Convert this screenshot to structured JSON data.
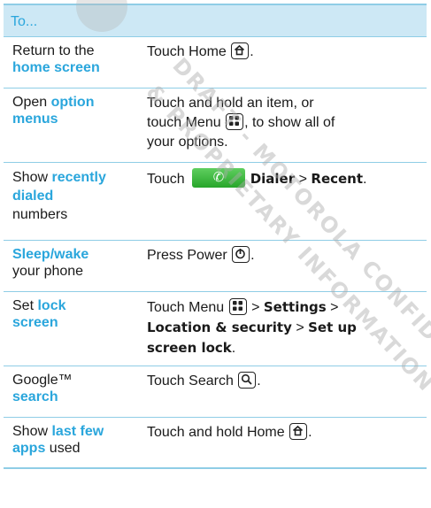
{
  "header": {
    "label": "To..."
  },
  "watermark": {
    "line1": "DRAFT - MOTOROLA CONFIDENTIAL",
    "line2": "& PROPRIETARY INFORMATION"
  },
  "rows": [
    {
      "c1a": "Return to the",
      "c1b": "home screen",
      "t1": "Touch Home",
      "t2": "."
    },
    {
      "c1a": "Open",
      "c1b": "option",
      "c1c": "menus",
      "t1": "Touch and hold an item, or",
      "t2": "touch Menu",
      "t3": ", to show all of",
      "t4": "your options."
    },
    {
      "c1a": "Show",
      "c1b": "recently",
      "c1c": "dialed",
      "c1d": "numbers",
      "t1": "Touch",
      "dialer": "Dialer",
      "sep": ">",
      "recent": "Recent",
      "dot": "."
    },
    {
      "c1a": "Sleep/wake",
      "c1b": "your phone",
      "t1": "Press Power",
      "t2": "."
    },
    {
      "c1a": "Set",
      "c1b": "lock",
      "c1c": "screen",
      "t1": "Touch Menu",
      "sep1": ">",
      "settings": "Settings",
      "sep2": ">",
      "loc": "Location & security",
      "sep3": ">",
      "setup": "Set up",
      "screen": "screen lock",
      "dot": "."
    },
    {
      "c1a": "Google™",
      "c1b": "search",
      "t1": "Touch Search",
      "t2": "."
    },
    {
      "c1a": "Show",
      "c1b": "last few",
      "c1c": "apps",
      "c1d": "used",
      "t1": "Touch and hold Home",
      "t2": "."
    }
  ]
}
